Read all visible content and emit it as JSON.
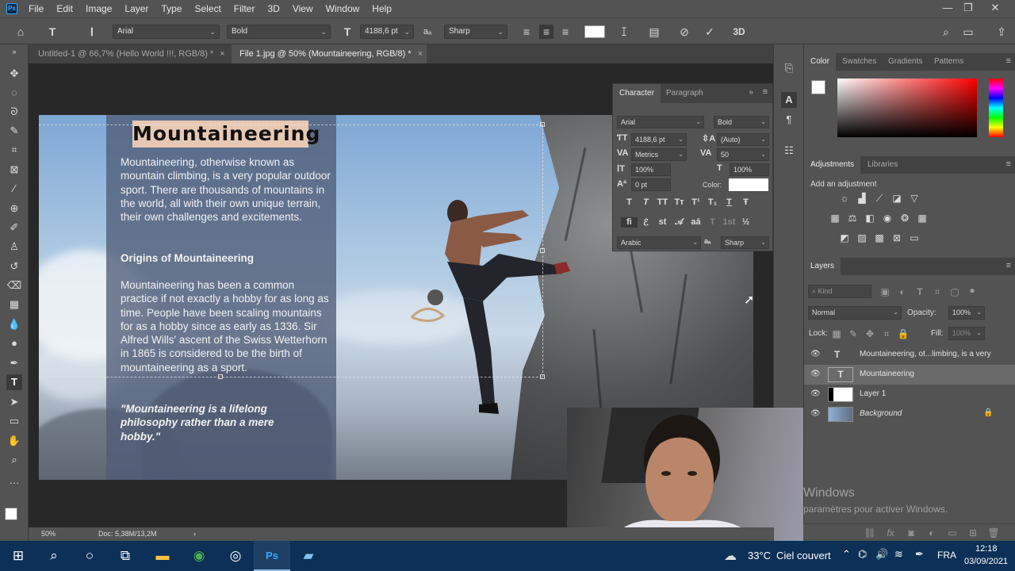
{
  "app": {
    "logo": "Ps"
  },
  "menu": [
    "File",
    "Edit",
    "Image",
    "Layer",
    "Type",
    "Select",
    "Filter",
    "3D",
    "View",
    "Window",
    "Help"
  ],
  "window_controls": [
    "—",
    "❐",
    "✕"
  ],
  "options_bar": {
    "font_family": "Arial",
    "font_style": "Bold",
    "font_size": "4188,6 pt",
    "aa_label": "aₐ",
    "anti_alias": "Sharp",
    "mode_3d": "3D"
  },
  "tabs": [
    {
      "label": "Untitled-1 @ 66,7% (Hello World !!!, RGB/8) *",
      "close": "×"
    },
    {
      "label": "File 1.jpg @ 50% (Mountaineering, RGB/8) *",
      "close": "×"
    }
  ],
  "canvas": {
    "title": "Mountaineering",
    "p1": " Mountaineering, otherwise known as mountain climbing, is a very popular outdoor sport. There are thousands of mountains in the world, all with their own unique terrain, their own challenges and excitements.",
    "h2": "Origins of Mountaineering",
    "p2": " Mountaineering has been a common practice if not exactly a hobby for as long as time. People have been scaling mountains for as a hobby since as early as 1336. Sir Alfred Wills' ascent of the Swiss Wetterhorn in 1865 is considered to be the birth of mountaineering as a sport.",
    "quote": "\"Mountaineering is a lifelong philosophy rather than a mere hobby.\""
  },
  "character_panel": {
    "tabs": [
      "Character",
      "Paragraph"
    ],
    "font_family": "Arial",
    "font_style": "Bold",
    "size": "4188,6 pt",
    "leading": "(Auto)",
    "kerning": "Metrics",
    "tracking": "50",
    "vscale": "100%",
    "hscale": "100%",
    "baseline": "0 pt",
    "color_label": "Color:",
    "language": "Arabic",
    "aa_label": "aₐ",
    "anti_alias": "Sharp",
    "style_buttons": [
      "T",
      "T",
      "TT",
      "Tт",
      "T¹",
      "T₁",
      "T",
      "Ŧ"
    ],
    "ot_buttons": [
      "fi",
      "ℰ",
      "st",
      "𝒜",
      "aā",
      "T",
      "1st",
      "½"
    ]
  },
  "color_panel": {
    "tabs": [
      "Color",
      "Swatches",
      "Gradients",
      "Patterns"
    ]
  },
  "adjustments_panel": {
    "tabs": [
      "Adjustments",
      "Libraries"
    ],
    "hint": "Add an adjustment"
  },
  "layers_panel": {
    "title": "Layers",
    "filter_placeholder": "Kind",
    "blend_mode": "Normal",
    "opacity_label": "Opacity:",
    "opacity": "100%",
    "lock_label": "Lock:",
    "fill_label": "Fill:",
    "fill": "100%",
    "layers": [
      {
        "name": "Mountaineering, ot...limbing, is a very",
        "type": "T",
        "selected": false
      },
      {
        "name": "Mountaineering",
        "type": "T",
        "selected": true
      },
      {
        "name": "Layer 1",
        "type": "image",
        "selected": false
      },
      {
        "name": "Background",
        "type": "image",
        "selected": false,
        "locked": true
      }
    ]
  },
  "activation": {
    "line1": "Windows",
    "line2": "paramètres pour activer Windows."
  },
  "status": {
    "zoom": "50%",
    "doc": "Doc: 5,38M/13,2M"
  },
  "taskbar": {
    "weather_temp": "33°C",
    "weather_text": "Ciel couvert",
    "lang": "FRA",
    "time": "12:18",
    "date": "03/09/2021"
  },
  "colors": {
    "ui_bg": "#535353",
    "canvas_bg": "#282828",
    "accent": "#31a8ff",
    "taskbar": "#0c3057",
    "title_bg": "#e7c9b3"
  }
}
